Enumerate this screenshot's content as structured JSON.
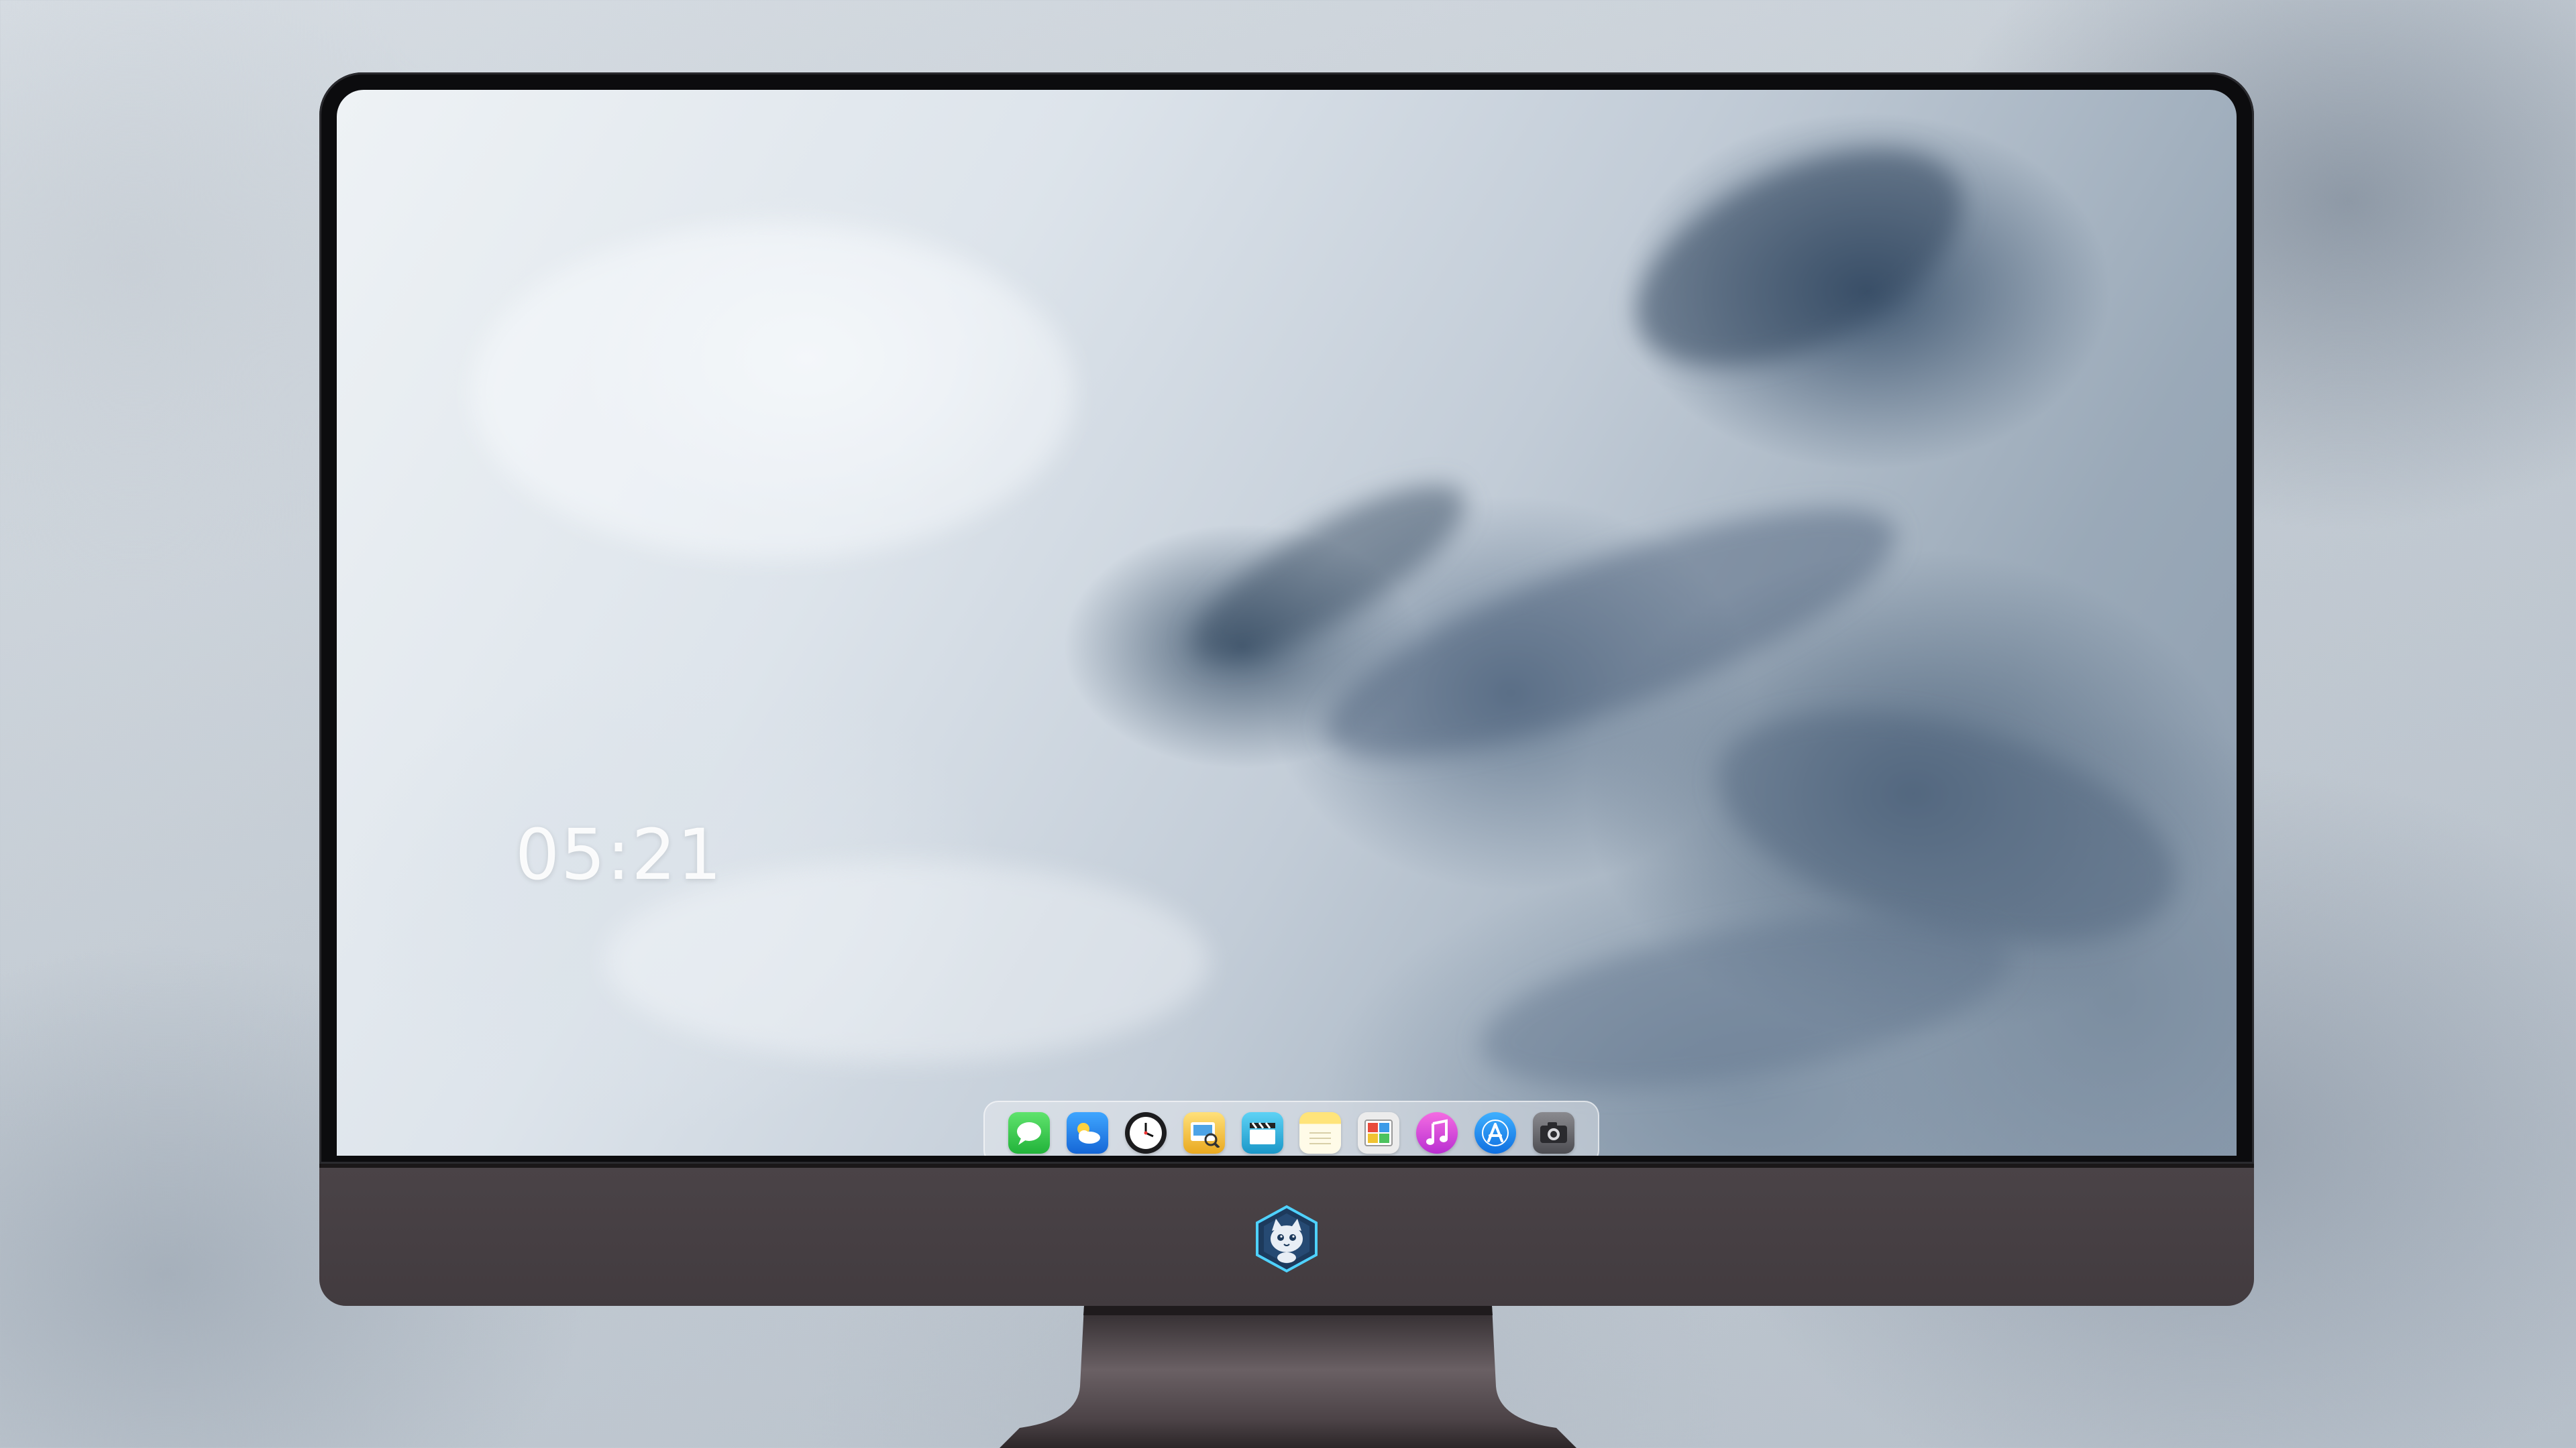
{
  "desktop": {
    "clock": "05:21"
  },
  "dock": {
    "items": [
      {
        "icon": "messages-icon",
        "color": "#3ccf4e"
      },
      {
        "icon": "weather-icon",
        "color": "#2f8ff0"
      },
      {
        "icon": "clock-icon",
        "color": "#1c1c1e"
      },
      {
        "icon": "preview-icon",
        "color": "#f3c335"
      },
      {
        "icon": "video-clapper-icon",
        "color": "#36b7e0"
      },
      {
        "icon": "notes-icon",
        "color": "#f7d34b"
      },
      {
        "icon": "photo-gallery-icon",
        "color": "#e8e8e8"
      },
      {
        "icon": "music-icon",
        "color": "#e244d3"
      },
      {
        "icon": "app-store-icon",
        "color": "#1e8cf3"
      },
      {
        "icon": "camera-icon",
        "color": "#5c5c60"
      }
    ]
  },
  "monitor": {
    "logo_icon": "cat-mascot-logo-icon"
  }
}
